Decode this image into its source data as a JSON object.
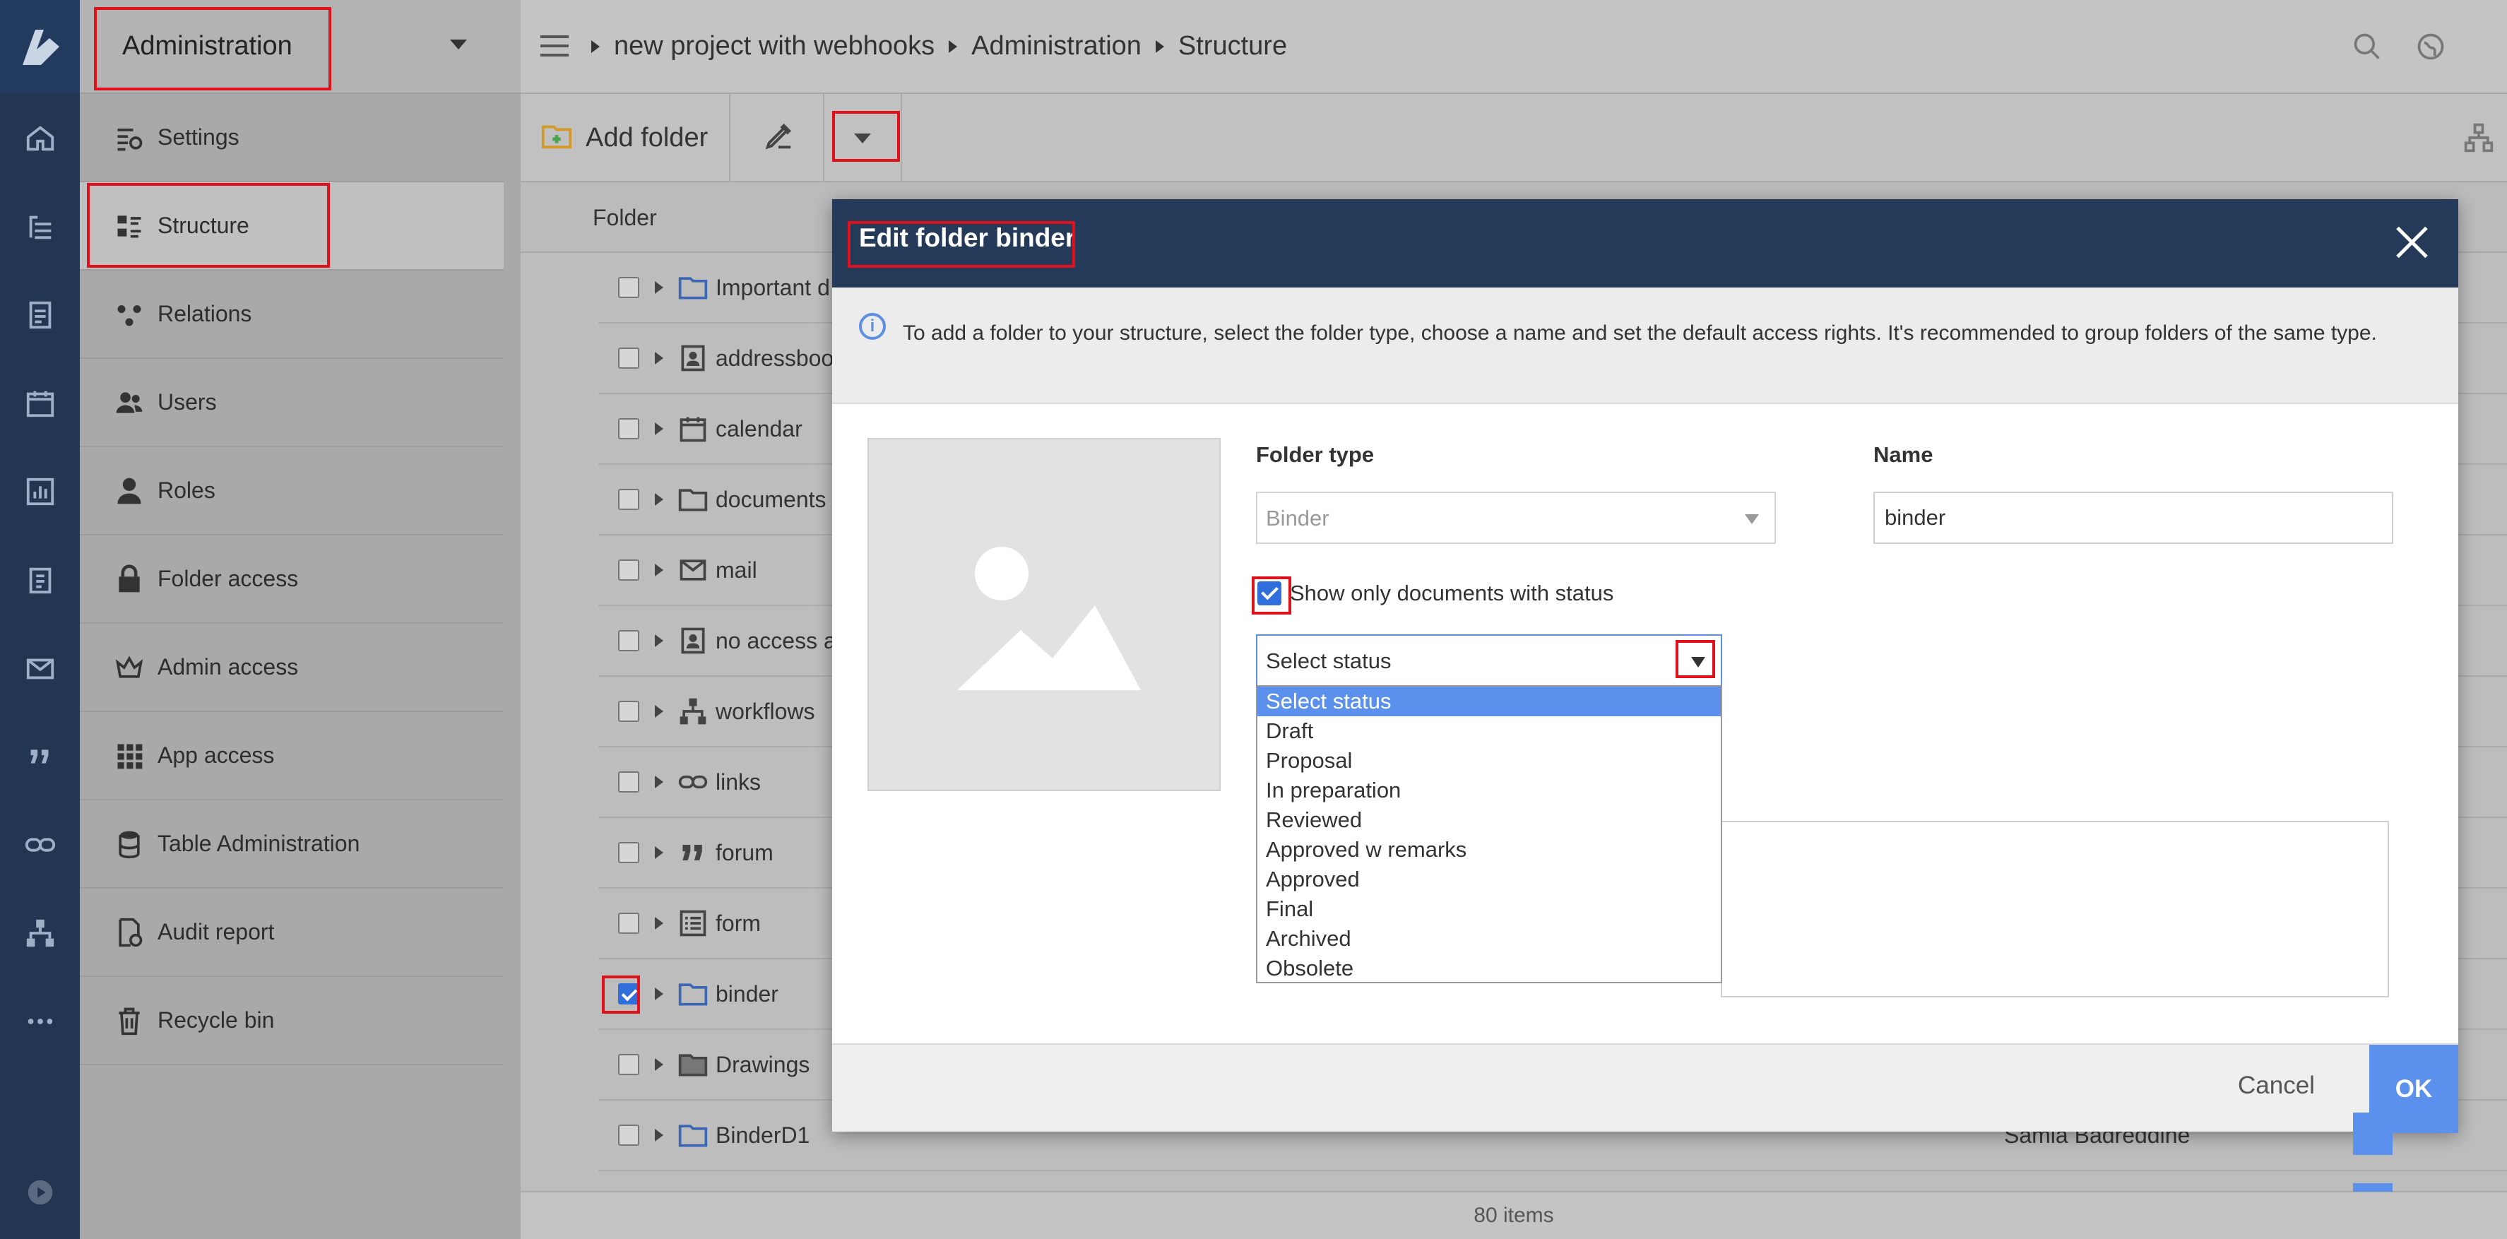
{
  "app": {
    "logo_icon": "app-logo-icon",
    "rail_icons": [
      "home-icon",
      "tree-icon",
      "addressbook-icon",
      "calendar-icon",
      "chart-icon",
      "clipboard-icon",
      "mail-icon",
      "quote-icon",
      "link-icon",
      "workflow-icon",
      "more-icon",
      "play-icon"
    ]
  },
  "menu": {
    "title": "Administration",
    "items": [
      {
        "label": "Settings",
        "icon": "settings-icon"
      },
      {
        "label": "Structure",
        "icon": "structure-icon",
        "active": true
      },
      {
        "label": "Relations",
        "icon": "relations-icon"
      },
      {
        "label": "Users",
        "icon": "users-icon"
      },
      {
        "label": "Roles",
        "icon": "roles-icon"
      },
      {
        "label": "Folder access",
        "icon": "lock-icon"
      },
      {
        "label": "Admin access",
        "icon": "crown-icon"
      },
      {
        "label": "App access",
        "icon": "grid-icon"
      },
      {
        "label": "Table Administration",
        "icon": "database-icon"
      },
      {
        "label": "Audit report",
        "icon": "audit-icon"
      },
      {
        "label": "Recycle bin",
        "icon": "trash-icon"
      }
    ]
  },
  "breadcrumb": [
    "new project with webhooks",
    "Administration",
    "Structure"
  ],
  "toolbar": {
    "add_folder": "Add folder"
  },
  "table": {
    "column_folder": "Folder",
    "rows": [
      {
        "name": "Important d",
        "icon": "folder-icon",
        "checked": false
      },
      {
        "name": "addressboo",
        "icon": "addressbook-icon",
        "checked": false
      },
      {
        "name": "calendar",
        "icon": "calendar-icon",
        "checked": false
      },
      {
        "name": "documents",
        "icon": "folder-icon",
        "checked": false
      },
      {
        "name": "mail",
        "icon": "mail-icon",
        "checked": false
      },
      {
        "name": "no access a",
        "icon": "addressbook-icon",
        "checked": false
      },
      {
        "name": "workflows",
        "icon": "workflow-icon",
        "checked": false
      },
      {
        "name": "links",
        "icon": "link-icon",
        "checked": false
      },
      {
        "name": "forum",
        "icon": "quote-icon",
        "checked": false
      },
      {
        "name": "form",
        "icon": "form-icon",
        "checked": false
      },
      {
        "name": "binder",
        "icon": "folder-icon",
        "checked": true
      },
      {
        "name": "Drawings",
        "icon": "drawings-folder-icon",
        "checked": false
      },
      {
        "name": "BinderD1",
        "icon": "folder-icon",
        "checked": false,
        "owner": "Samia Badreddine"
      }
    ],
    "count": "80 items"
  },
  "dialog": {
    "title": "Edit folder binder",
    "info": "To add a folder to your structure, select the folder type, choose a name and set the default access rights. It's recommended to group folders of the same type.",
    "folder_type_label": "Folder type",
    "folder_type_value": "Binder",
    "name_label": "Name",
    "name_value": "binder",
    "show_status_label": "Show only documents with status",
    "show_status_checked": true,
    "status_select_value": "Select status",
    "status_options": [
      "Select status",
      "Draft",
      "Proposal",
      "In preparation",
      "Reviewed",
      "Approved w remarks",
      "Approved",
      "Final",
      "Archived",
      "Obsolete"
    ],
    "cancel_label": "Cancel",
    "ok_label": "OK"
  },
  "colors": {
    "rail": "#223551",
    "dialog_header": "#253a59",
    "accent": "#5b90ec",
    "highlight": "#e0111b"
  }
}
